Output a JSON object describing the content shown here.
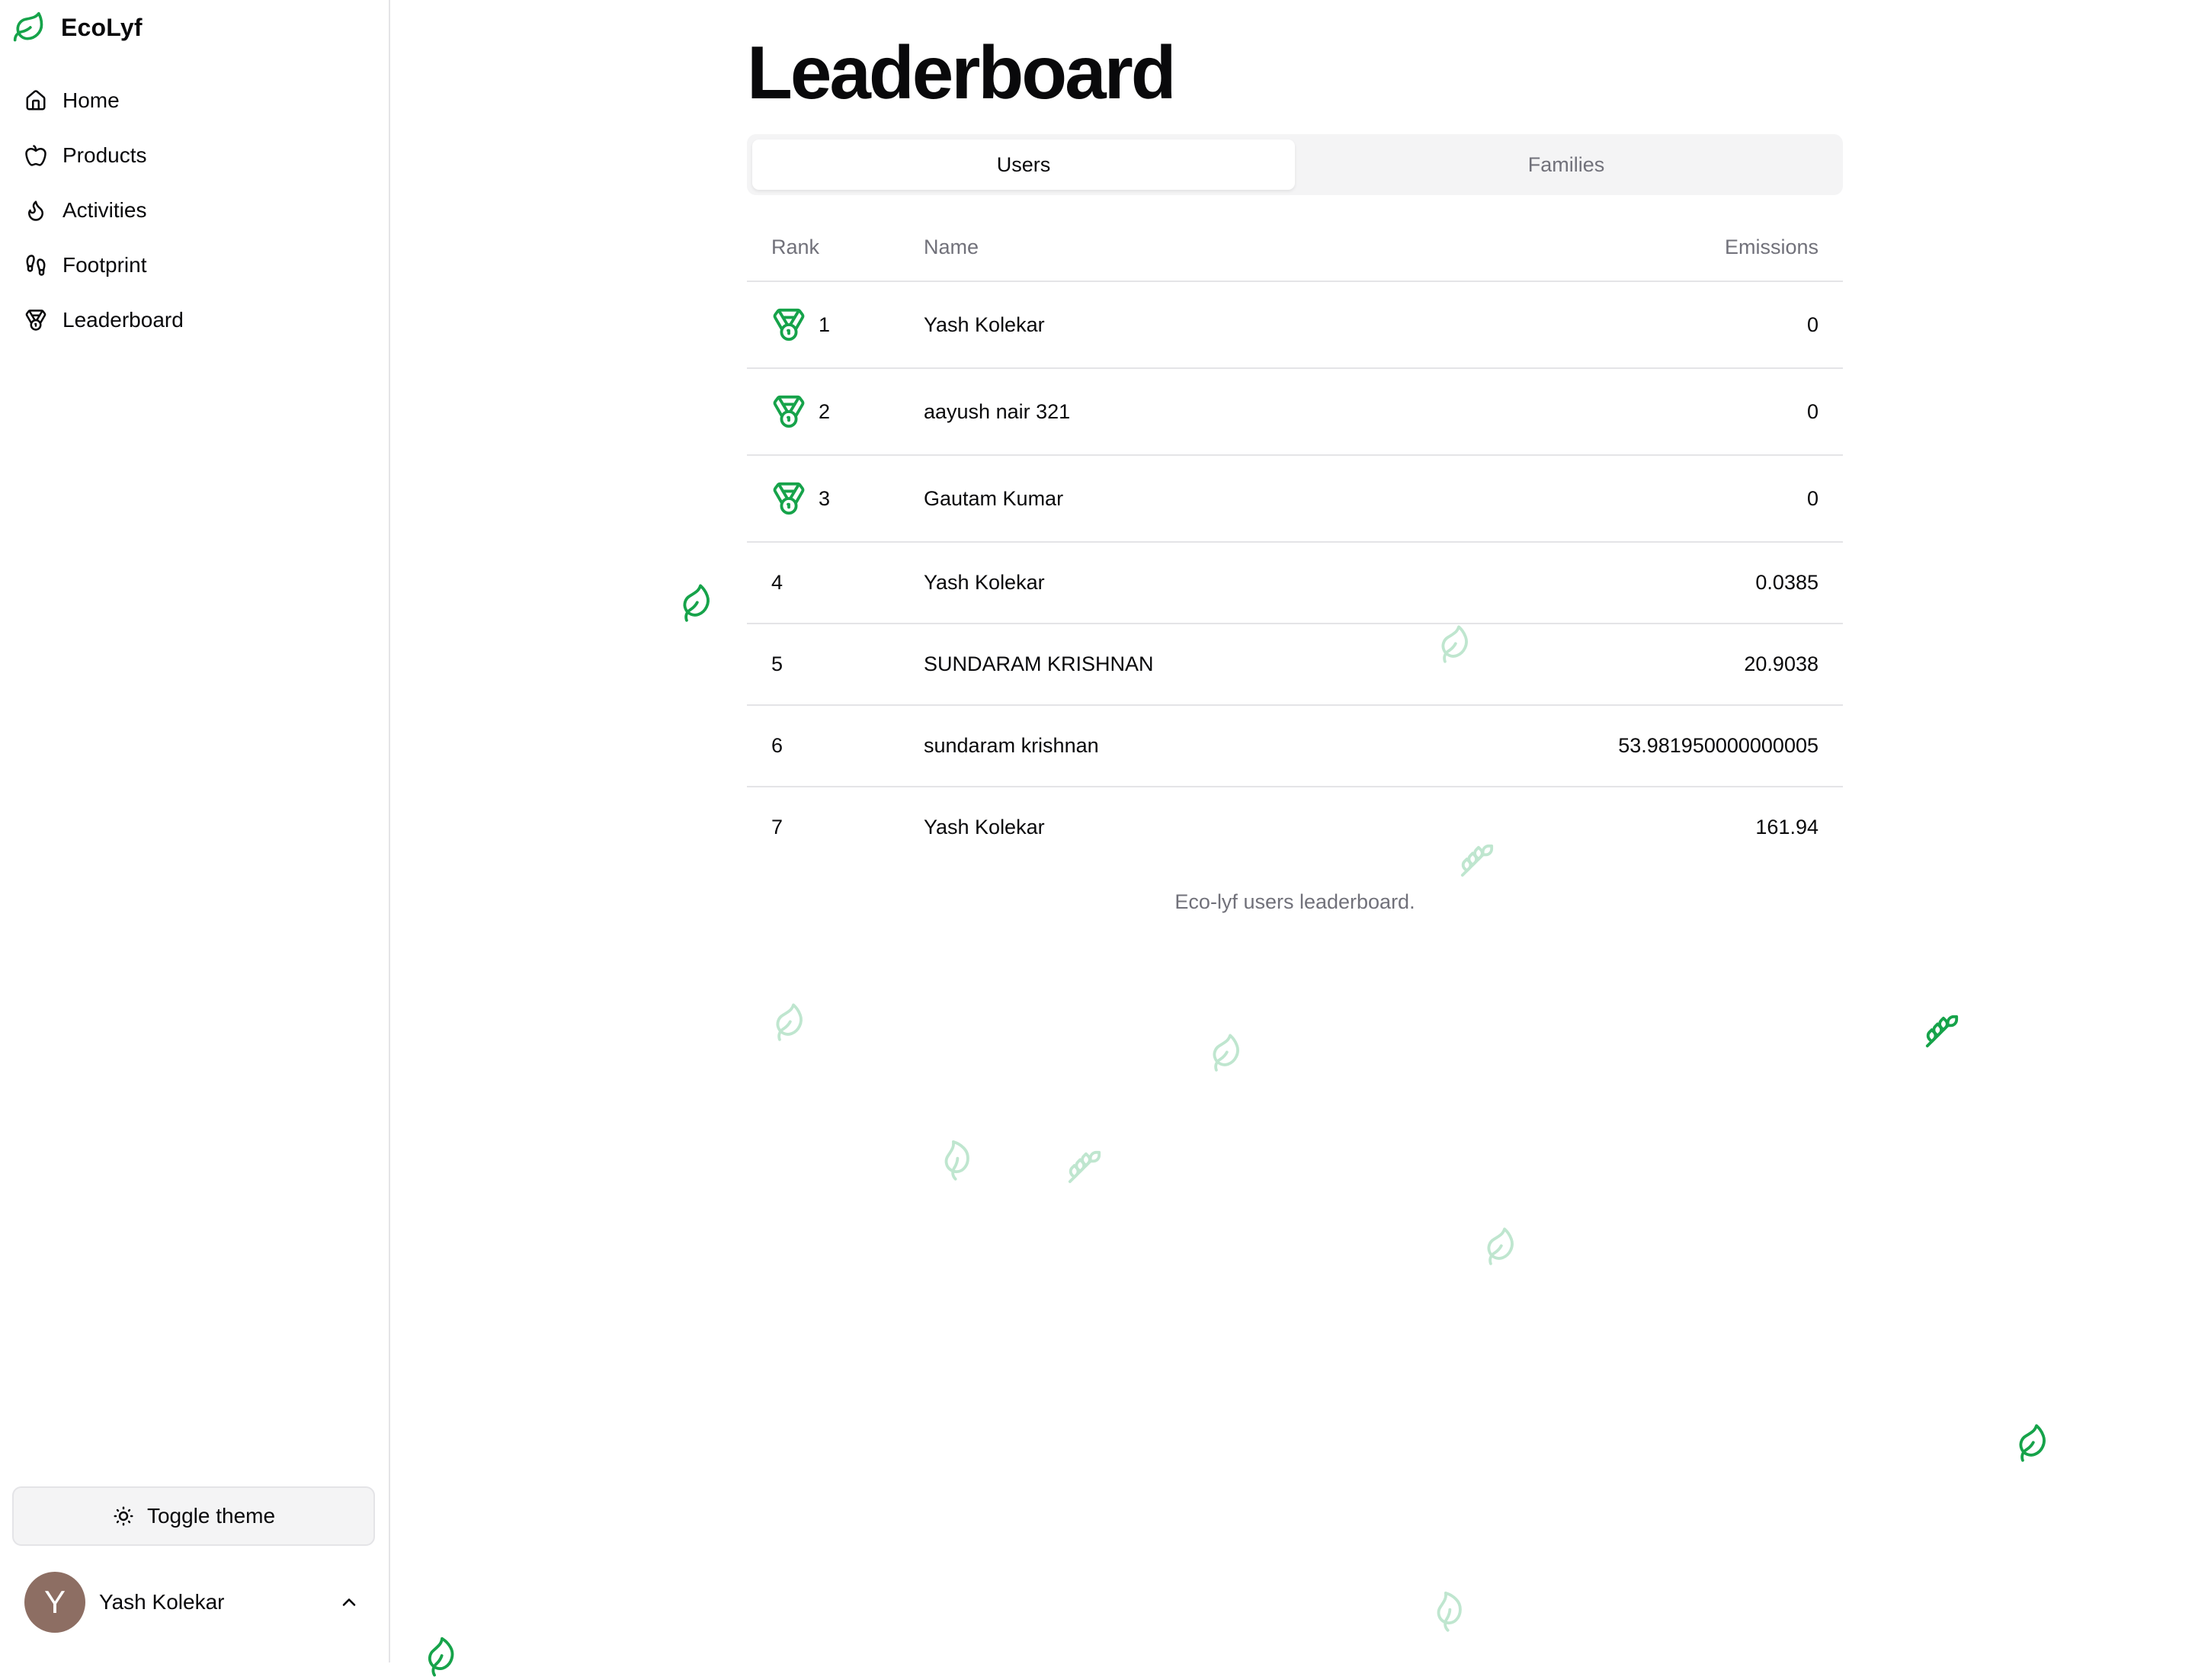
{
  "app": {
    "name": "EcoLyf",
    "logo_icon": "leaf-icon",
    "accent_color": "#16a34a"
  },
  "sidebar": {
    "items": [
      {
        "label": "Home",
        "icon": "house-icon"
      },
      {
        "label": "Products",
        "icon": "apple-icon"
      },
      {
        "label": "Activities",
        "icon": "flame-icon"
      },
      {
        "label": "Footprint",
        "icon": "footprints-icon"
      },
      {
        "label": "Leaderboard",
        "icon": "medal-icon"
      }
    ],
    "toggle_theme_label": "Toggle theme",
    "user": {
      "name": "Yash Kolekar",
      "avatar_initial": "Y",
      "avatar_color": "#8d6e63"
    }
  },
  "main": {
    "title": "Leaderboard",
    "tabs": [
      {
        "label": "Users",
        "active": true
      },
      {
        "label": "Families",
        "active": false
      }
    ],
    "table": {
      "headers": {
        "rank": "Rank",
        "name": "Name",
        "emissions": "Emissions"
      },
      "rows": [
        {
          "rank": "1",
          "name": "Yash Kolekar",
          "emissions": "0",
          "medal": true
        },
        {
          "rank": "2",
          "name": "aayush nair 321",
          "emissions": "0",
          "medal": true
        },
        {
          "rank": "3",
          "name": "Gautam Kumar",
          "emissions": "0",
          "medal": true
        },
        {
          "rank": "4",
          "name": "Yash Kolekar",
          "emissions": "0.0385",
          "medal": false
        },
        {
          "rank": "5",
          "name": "SUNDARAM KRISHNAN",
          "emissions": "20.9038",
          "medal": false
        },
        {
          "rank": "6",
          "name": "sundaram krishnan",
          "emissions": "53.981950000000005",
          "medal": false
        },
        {
          "rank": "7",
          "name": "Yash Kolekar",
          "emissions": "161.94",
          "medal": false
        }
      ],
      "caption": "Eco-lyf users leaderboard."
    }
  }
}
